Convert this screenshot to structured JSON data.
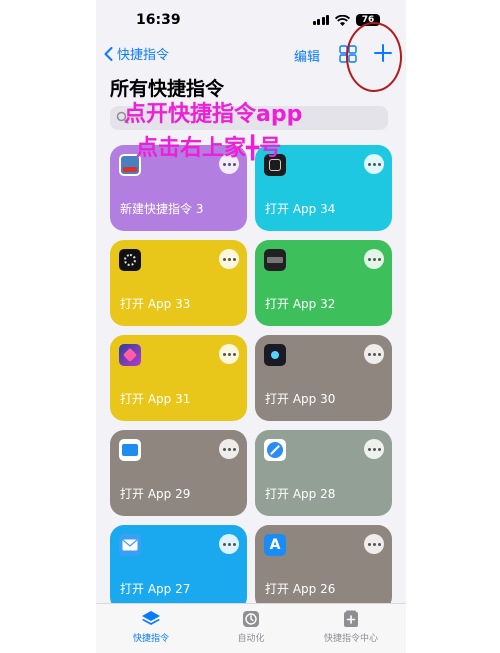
{
  "status_bar": {
    "time": "16:39",
    "battery": "76"
  },
  "nav": {
    "back_label": "快捷指令",
    "edit_label": "编辑"
  },
  "page": {
    "title": "所有快捷指令",
    "search_placeholder": ""
  },
  "annotation": {
    "line1": "点开快捷指令app",
    "line2": "点击右上家╋号",
    "color": "#ee1fd8"
  },
  "tiles": [
    {
      "label": "新建快捷指令 3",
      "color": "#b27fe0",
      "icon": "shortcut-thumbnail-icon"
    },
    {
      "label": "打开 App 34",
      "color": "#1ec8e0",
      "icon": "app-icon-dark"
    },
    {
      "label": "打开 App 33",
      "color": "#e8c61a",
      "icon": "watch-app-icon"
    },
    {
      "label": "打开 App 32",
      "color": "#3dc05c",
      "icon": "dark-app-icon"
    },
    {
      "label": "打开 App 31",
      "color": "#e8c61a",
      "icon": "shortcuts-app-icon"
    },
    {
      "label": "打开 App 30",
      "color": "#8f8680",
      "icon": "space-app-icon"
    },
    {
      "label": "打开 App 29",
      "color": "#8f8680",
      "icon": "files-app-icon"
    },
    {
      "label": "打开 App 28",
      "color": "#92a096",
      "icon": "safari-icon"
    },
    {
      "label": "打开 App 27",
      "color": "#1aa8ef",
      "icon": "mail-icon"
    },
    {
      "label": "打开 App 26",
      "color": "#8f8680",
      "icon": "app-store-icon"
    }
  ],
  "tabbar": [
    {
      "label": "快捷指令",
      "active": true
    },
    {
      "label": "自动化",
      "active": false
    },
    {
      "label": "快捷指令中心",
      "active": false
    }
  ],
  "colors": {
    "accent": "#0a7aff",
    "background": "#f2f2f7"
  }
}
